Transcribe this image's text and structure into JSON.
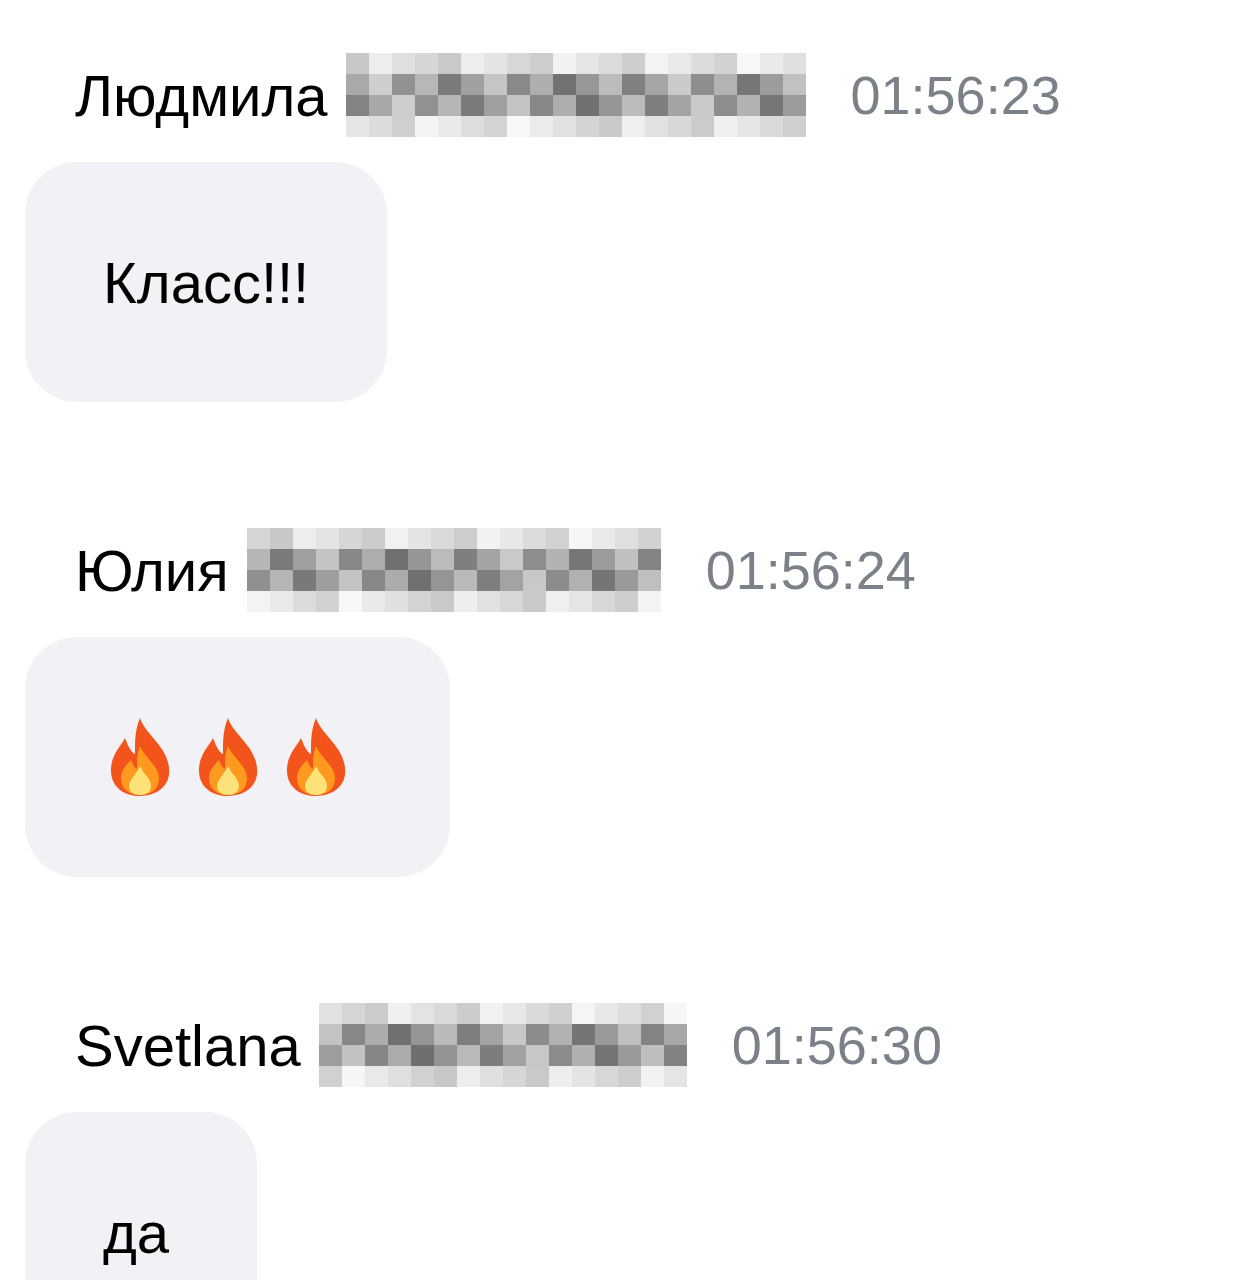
{
  "messages": [
    {
      "author": "Людмила",
      "surname_redacted": true,
      "time": "01:56:23",
      "kind": "text",
      "text": "Класс!!!"
    },
    {
      "author": "Юлия",
      "surname_redacted": true,
      "time": "01:56:24",
      "kind": "emoji",
      "emojis": [
        {
          "kind": "fire"
        },
        {
          "kind": "fire"
        },
        {
          "kind": "fire"
        }
      ]
    },
    {
      "author": "Svetlana",
      "surname_redacted": true,
      "time": "01:56:30",
      "kind": "text",
      "text": "да"
    }
  ]
}
